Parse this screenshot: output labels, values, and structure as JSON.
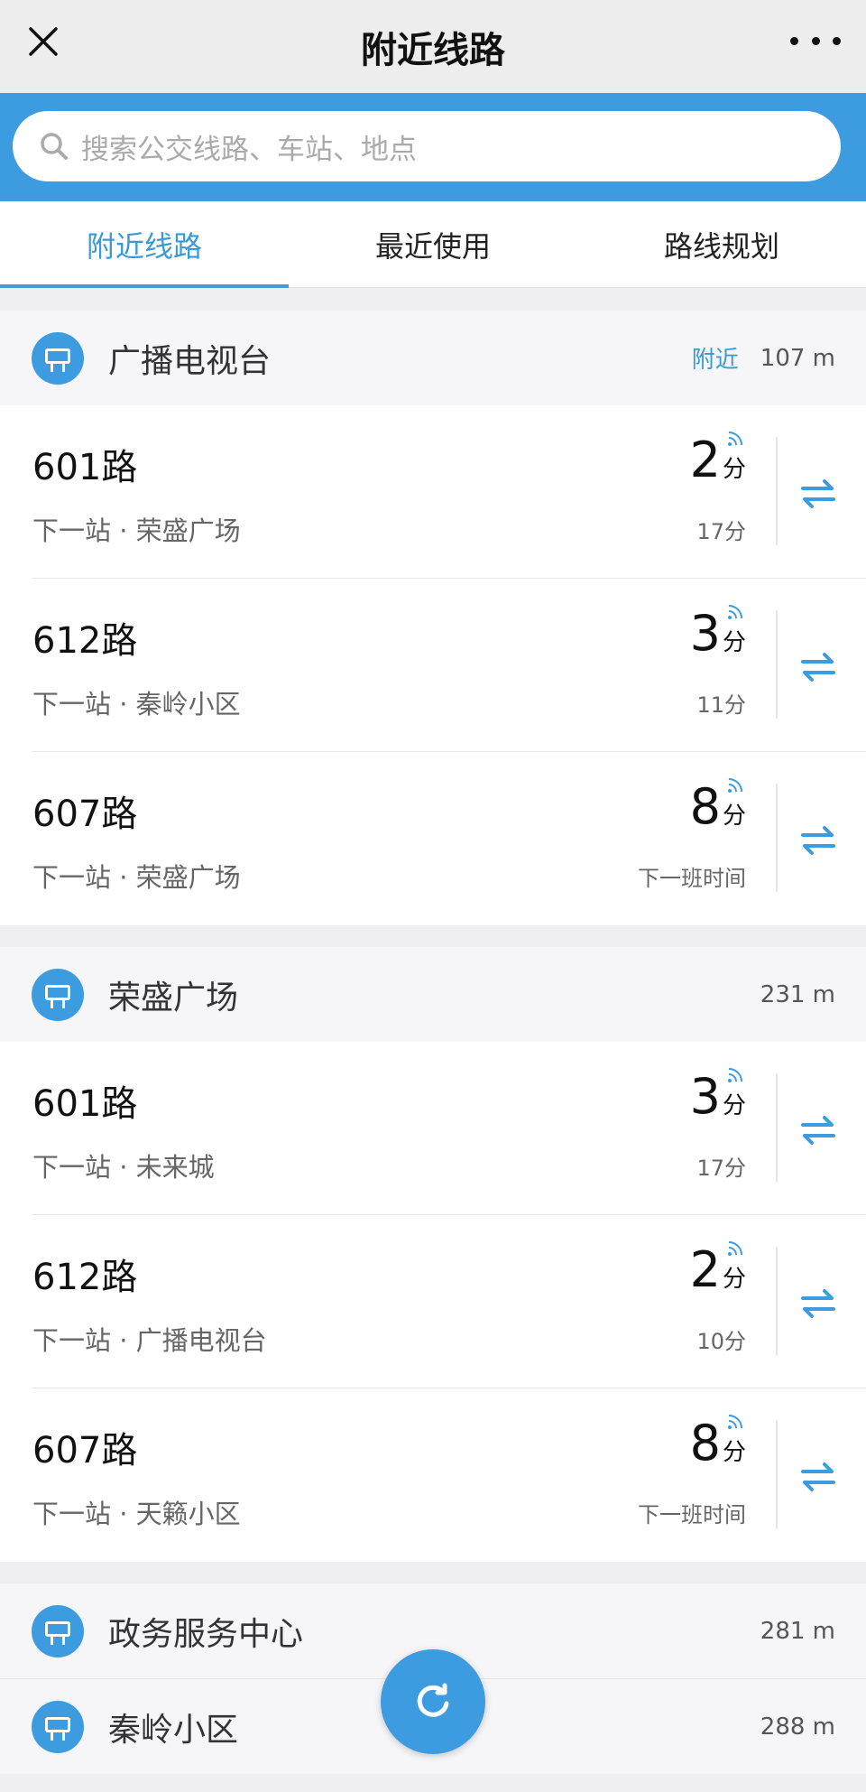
{
  "app": {
    "title": "附近线路"
  },
  "search": {
    "placeholder": "搜索公交线路、车站、地点"
  },
  "tabs": [
    {
      "label": "附近线路",
      "active": true
    },
    {
      "label": "最近使用",
      "active": false
    },
    {
      "label": "路线规划",
      "active": false
    }
  ],
  "colors": {
    "accent": "#3d9be0",
    "accent_text": "#3a9ad6"
  },
  "stations": [
    {
      "name": "广播电视台",
      "near_label": "附近",
      "distance": "107 m",
      "lines": [
        {
          "name": "601路",
          "next_stop": "下一站 · 荣盛广场",
          "eta": "2",
          "eta_unit": "分",
          "sub": "17分"
        },
        {
          "name": "612路",
          "next_stop": "下一站 · 秦岭小区",
          "eta": "3",
          "eta_unit": "分",
          "sub": "11分"
        },
        {
          "name": "607路",
          "next_stop": "下一站 · 荣盛广场",
          "eta": "8",
          "eta_unit": "分",
          "sub": "下一班时间"
        }
      ]
    },
    {
      "name": "荣盛广场",
      "distance": "231 m",
      "lines": [
        {
          "name": "601路",
          "next_stop": "下一站 · 未来城",
          "eta": "3",
          "eta_unit": "分",
          "sub": "17分"
        },
        {
          "name": "612路",
          "next_stop": "下一站 · 广播电视台",
          "eta": "2",
          "eta_unit": "分",
          "sub": "10分"
        },
        {
          "name": "607路",
          "next_stop": "下一站 · 天籁小区",
          "eta": "8",
          "eta_unit": "分",
          "sub": "下一班时间"
        }
      ]
    },
    {
      "name": "政务服务中心",
      "distance": "281 m"
    },
    {
      "name": "秦岭小区",
      "distance": "288 m"
    }
  ],
  "icons": {
    "close": "close-icon",
    "more": "more-icon",
    "search": "search-icon",
    "station": "bus-stop-icon",
    "signal": "realtime-signal-icon",
    "swap": "swap-direction-icon",
    "refresh": "refresh-icon"
  }
}
